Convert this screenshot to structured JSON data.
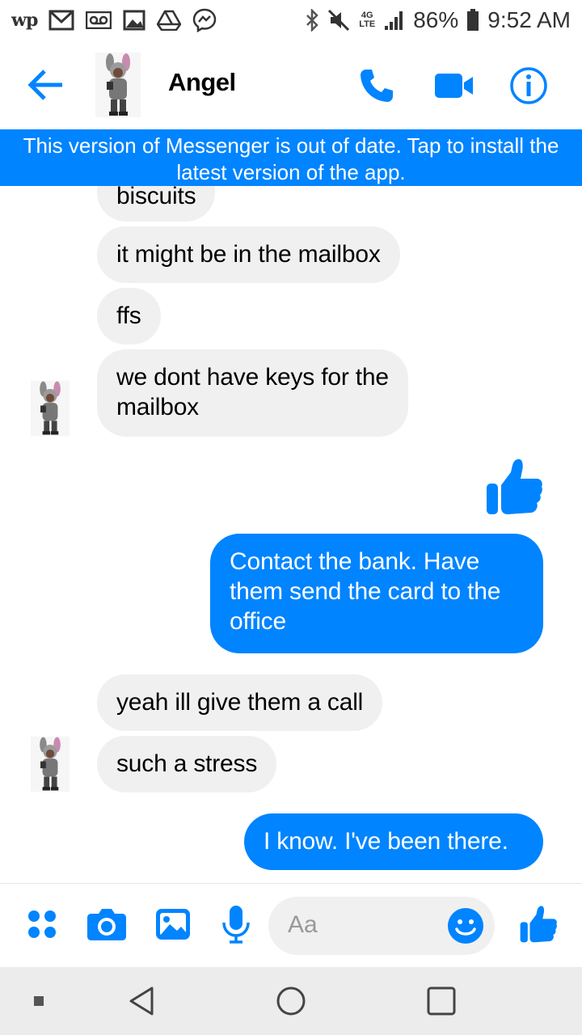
{
  "status_bar": {
    "left_icons": [
      "washington-post-icon",
      "gmail-icon",
      "voicemail-icon",
      "gallery-icon",
      "drive-icon",
      "messenger-icon"
    ],
    "wp_label": "wp",
    "network": "4G LTE",
    "battery": "86%",
    "time": "9:52 AM"
  },
  "header": {
    "contact_name": "Angel"
  },
  "banner": {
    "text": "This version of Messenger is out of date. Tap to install the latest version of the app."
  },
  "messages": [
    {
      "sender": "them",
      "text": "biscuits"
    },
    {
      "sender": "them",
      "text": "it might be in the mailbox"
    },
    {
      "sender": "them",
      "text": "ffs"
    },
    {
      "sender": "them",
      "text_line1": "we dont have keys for the",
      "text_line2": "mailbox"
    },
    {
      "sender": "me",
      "type": "like-sticker"
    },
    {
      "sender": "me",
      "text_line1": "Contact the bank. Have",
      "text_line2": "them send the card to the",
      "text_line3": "office"
    },
    {
      "sender": "them",
      "text": "yeah ill give them a call"
    },
    {
      "sender": "them",
      "text": "such a stress"
    },
    {
      "sender": "me",
      "text": "I know. I've been there."
    }
  ],
  "composer": {
    "placeholder": "Aa"
  },
  "colors": {
    "accent": "#0084ff",
    "incoming_bubble": "#f1f0f0",
    "navbar": "#ececec"
  }
}
